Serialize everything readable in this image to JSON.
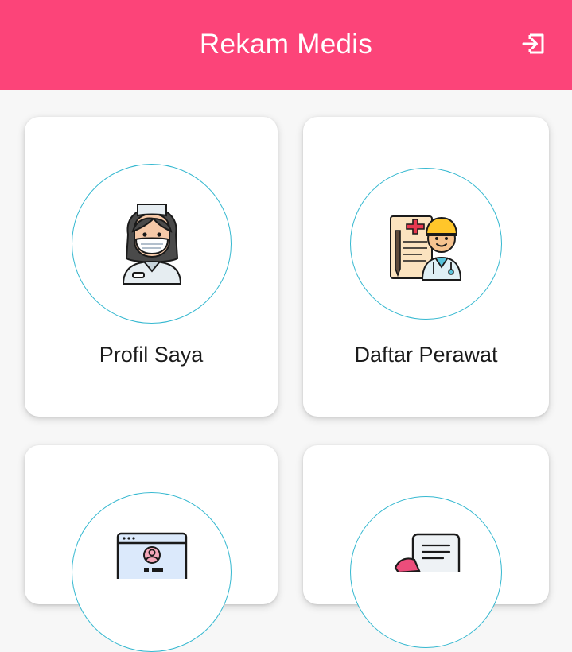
{
  "app_bar": {
    "title": "Rekam Medis",
    "logout_icon": "logout-icon",
    "background_color": "#fc4479"
  },
  "menu": {
    "items": [
      {
        "label": "Profil Saya",
        "icon": "nurse-icon"
      },
      {
        "label": "Daftar Perawat",
        "icon": "doctor-clipboard-icon"
      },
      {
        "label": "",
        "icon": "profile-screen-icon"
      },
      {
        "label": "",
        "icon": "medical-document-icon"
      }
    ],
    "circle_border_color": "#35b8d0"
  }
}
